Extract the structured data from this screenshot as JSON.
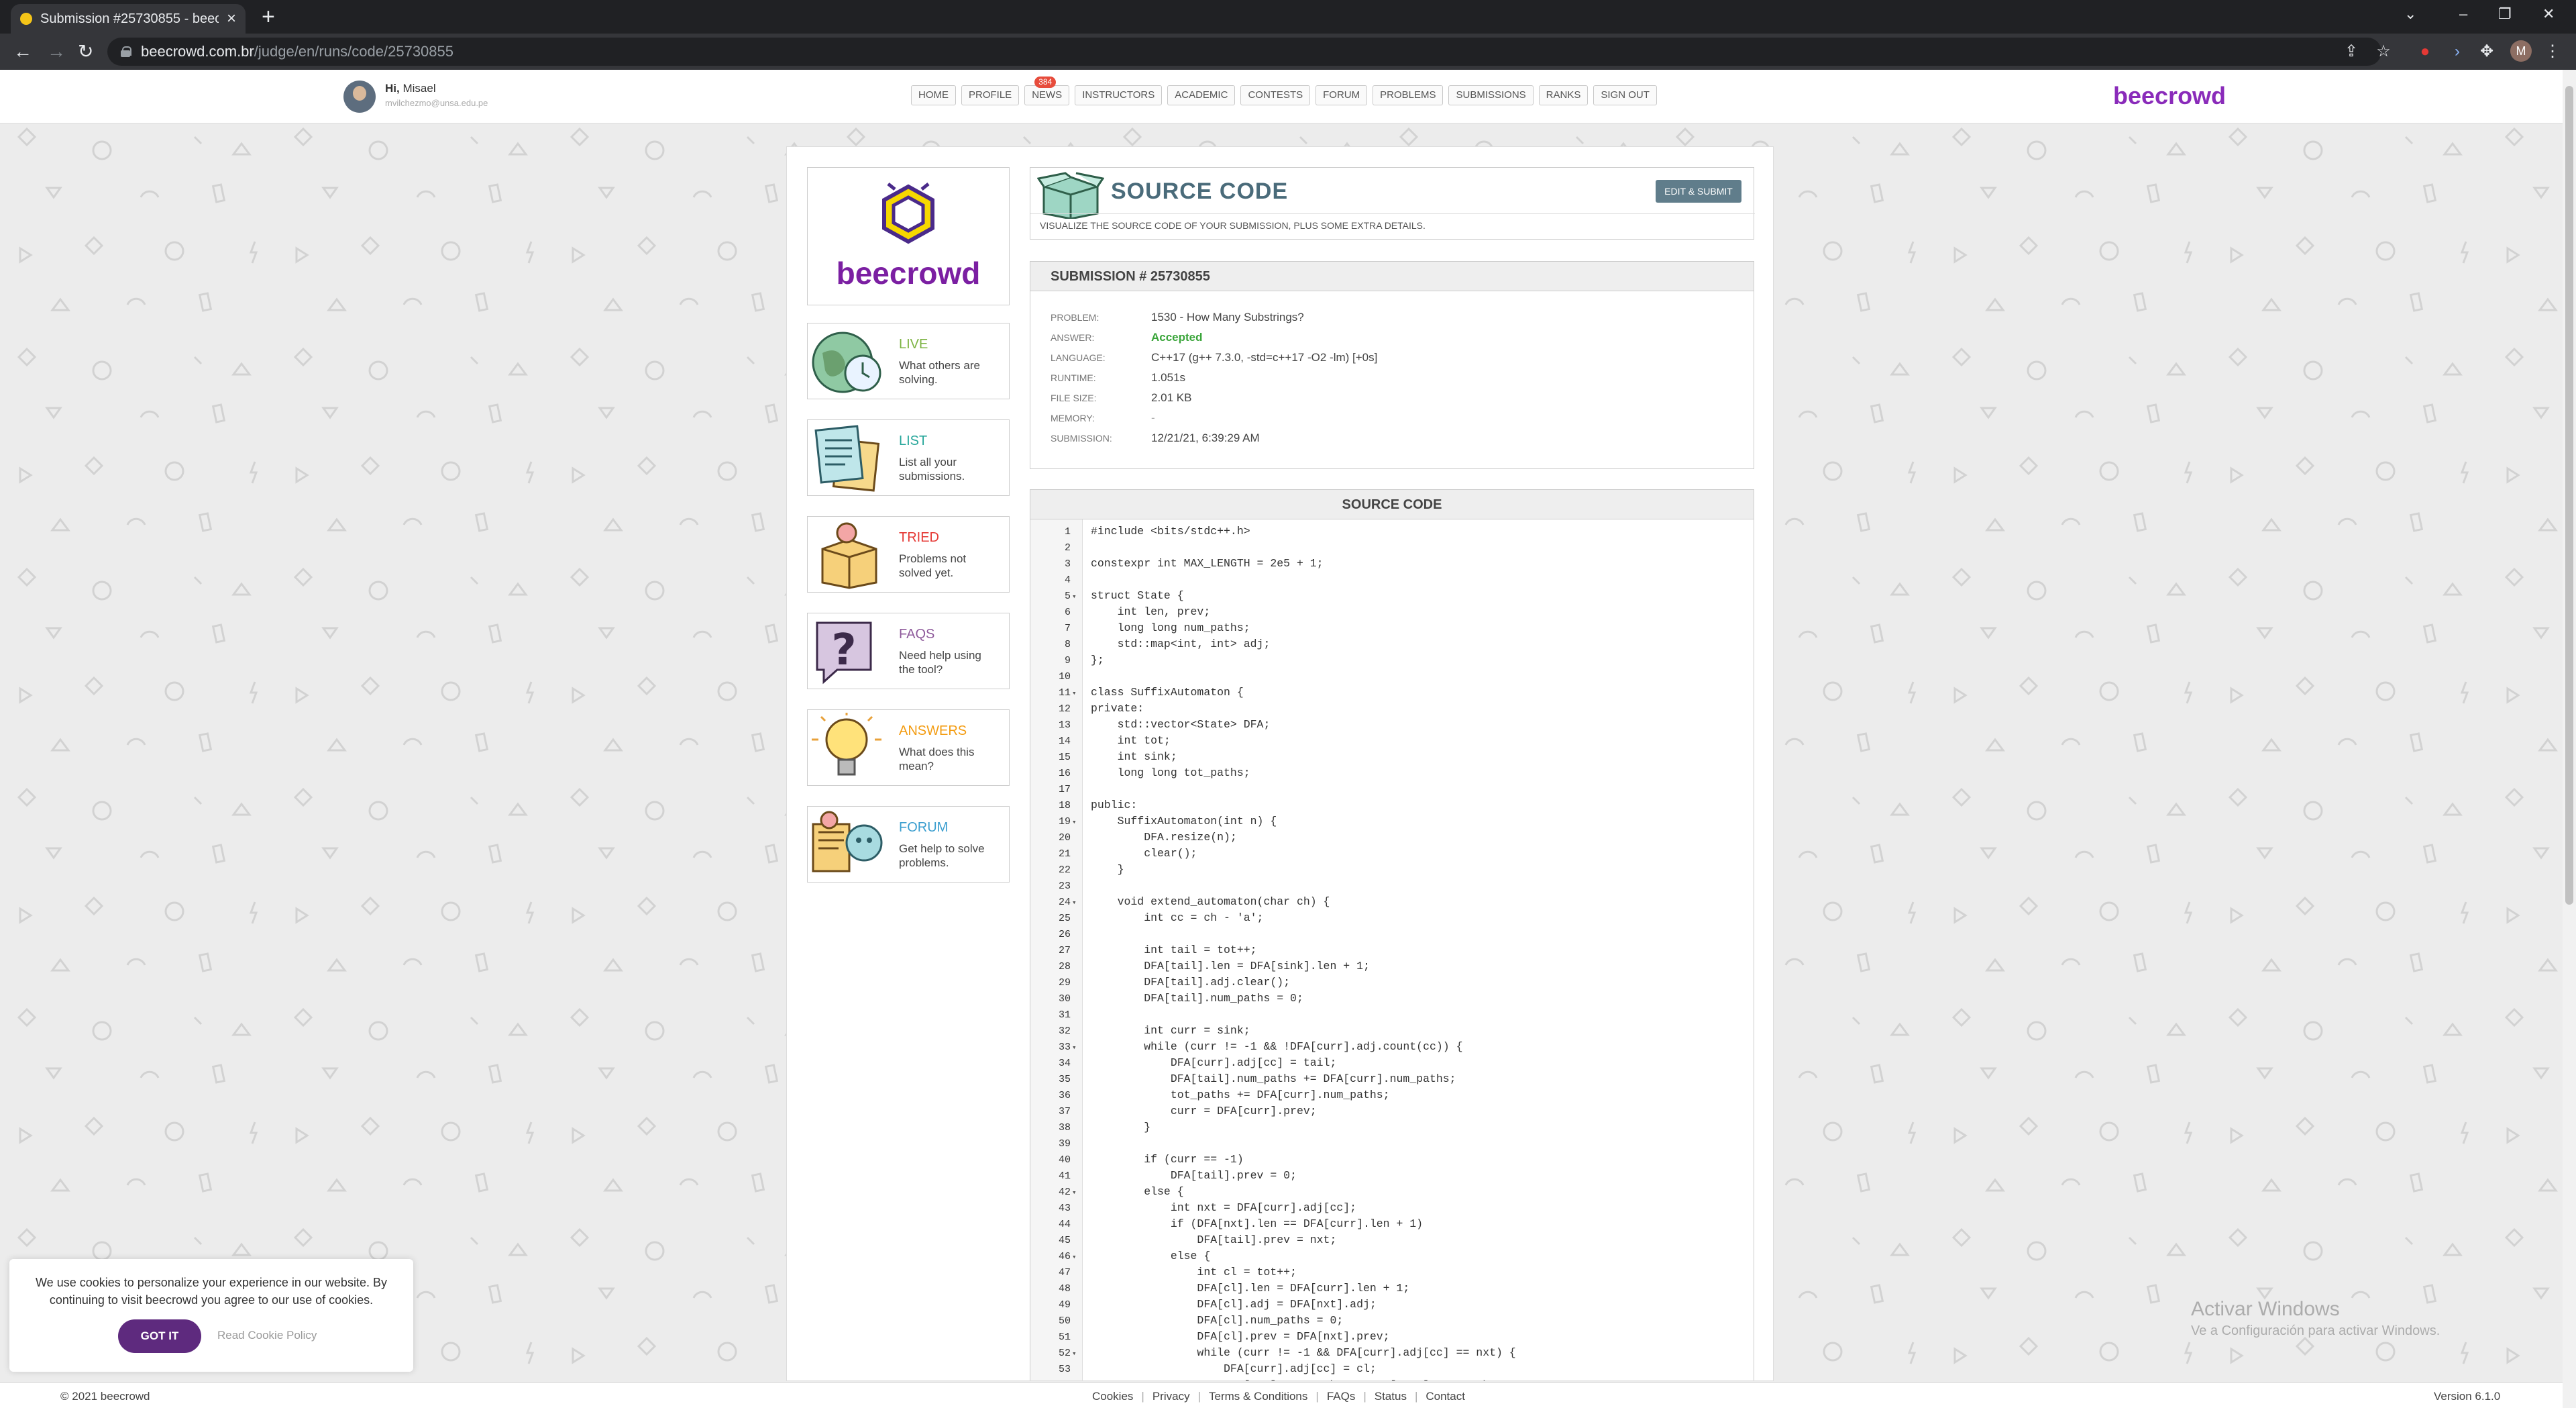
{
  "browser": {
    "tab_title": "Submission #25730855 - beecrowd",
    "url_host": "beecrowd.com.br",
    "url_path": "/judge/en/runs/code/25730855",
    "profile_initial": "M"
  },
  "header": {
    "greeting_prefix": "Hi,",
    "user_name": "Misael",
    "user_email": "mvilchezmo@unsa.edu.pe",
    "nav": [
      "HOME",
      "PROFILE",
      "NEWS",
      "INSTRUCTORS",
      "ACADEMIC",
      "CONTESTS",
      "FORUM",
      "PROBLEMS",
      "SUBMISSIONS",
      "RANKS",
      "SIGN OUT"
    ],
    "news_badge": "384",
    "brand": "beecrowd"
  },
  "sidebar": {
    "logo_text": "beecrowd",
    "cards": [
      {
        "title": "LIVE",
        "desc": "What others are solving.",
        "color": "#7cb342"
      },
      {
        "title": "LIST",
        "desc": "List all your submissions.",
        "color": "#26a69a"
      },
      {
        "title": "TRIED",
        "desc": "Problems not solved yet.",
        "color": "#e53935"
      },
      {
        "title": "FAQS",
        "desc": "Need help using the tool?",
        "color": "#8e5a9b"
      },
      {
        "title": "ANSWERS",
        "desc": "What does this mean?",
        "color": "#f39c12"
      },
      {
        "title": "FORUM",
        "desc": "Get help to solve problems.",
        "color": "#3b9ecf"
      }
    ]
  },
  "source_header": {
    "title": "SOURCE CODE",
    "subtitle": "VISUALIZE THE SOURCE CODE OF YOUR SUBMISSION, PLUS SOME EXTRA DETAILS.",
    "edit_button": "EDIT & SUBMIT"
  },
  "submission": {
    "heading": "SUBMISSION # 25730855",
    "rows": [
      {
        "key": "PROBLEM:",
        "value": "1530 - How Many Substrings?"
      },
      {
        "key": "ANSWER:",
        "value": "Accepted"
      },
      {
        "key": "LANGUAGE:",
        "value": "C++17 (g++ 7.3.0, -std=c++17 -O2 -lm) [+0s]"
      },
      {
        "key": "RUNTIME:",
        "value": "1.051s"
      },
      {
        "key": "FILE SIZE:",
        "value": "2.01 KB"
      },
      {
        "key": "MEMORY:",
        "value": "-"
      },
      {
        "key": "SUBMISSION:",
        "value": "12/21/21, 6:39:29 AM"
      }
    ]
  },
  "code": {
    "heading": "SOURCE CODE",
    "fold_lines": [
      5,
      11,
      19,
      24,
      33,
      42,
      46,
      52
    ],
    "lines": [
      "#include <bits/stdc++.h>",
      "",
      "constexpr int MAX_LENGTH = 2e5 + 1;",
      "",
      "struct State {",
      "    int len, prev;",
      "    long long num_paths;",
      "    std::map<int, int> adj;",
      "};",
      "",
      "class SuffixAutomaton {",
      "private:",
      "    std::vector<State> DFA;",
      "    int tot;",
      "    int sink;",
      "    long long tot_paths;",
      "",
      "public:",
      "    SuffixAutomaton(int n) {",
      "        DFA.resize(n);",
      "        clear();",
      "    }",
      "",
      "    void extend_automaton(char ch) {",
      "        int cc = ch - 'a';",
      "",
      "        int tail = tot++;",
      "        DFA[tail].len = DFA[sink].len + 1;",
      "        DFA[tail].adj.clear();",
      "        DFA[tail].num_paths = 0;",
      "",
      "        int curr = sink;",
      "        while (curr != -1 && !DFA[curr].adj.count(cc)) {",
      "            DFA[curr].adj[cc] = tail;",
      "            DFA[tail].num_paths += DFA[curr].num_paths;",
      "            tot_paths += DFA[curr].num_paths;",
      "            curr = DFA[curr].prev;",
      "        }",
      "",
      "        if (curr == -1)",
      "            DFA[tail].prev = 0;",
      "        else {",
      "            int nxt = DFA[curr].adj[cc];",
      "            if (DFA[nxt].len == DFA[curr].len + 1)",
      "                DFA[tail].prev = nxt;",
      "            else {",
      "                int cl = tot++;",
      "                DFA[cl].len = DFA[curr].len + 1;",
      "                DFA[cl].adj = DFA[nxt].adj;",
      "                DFA[cl].num_paths = 0;",
      "                DFA[cl].prev = DFA[nxt].prev;",
      "                while (curr != -1 && DFA[curr].adj[cc] == nxt) {",
      "                    DFA[curr].adj[cc] = cl;",
      "                    DFA[nxt].num_paths -= DFA[curr].num_paths;"
    ]
  },
  "cookie": {
    "message": "We use cookies to personalize your experience in our website. By continuing to visit beecrowd you agree to our use of cookies.",
    "accept": "GOT IT",
    "policy": "Read Cookie Policy"
  },
  "watermark": {
    "line1": "Activar Windows",
    "line2": "Ve a Configuración para activar Windows."
  },
  "footer": {
    "copyright": "© 2021 beecrowd",
    "links": [
      "Cookies",
      "Privacy",
      "Terms & Conditions",
      "FAQs",
      "Status",
      "Contact"
    ],
    "version": "Version 6.1.0"
  }
}
